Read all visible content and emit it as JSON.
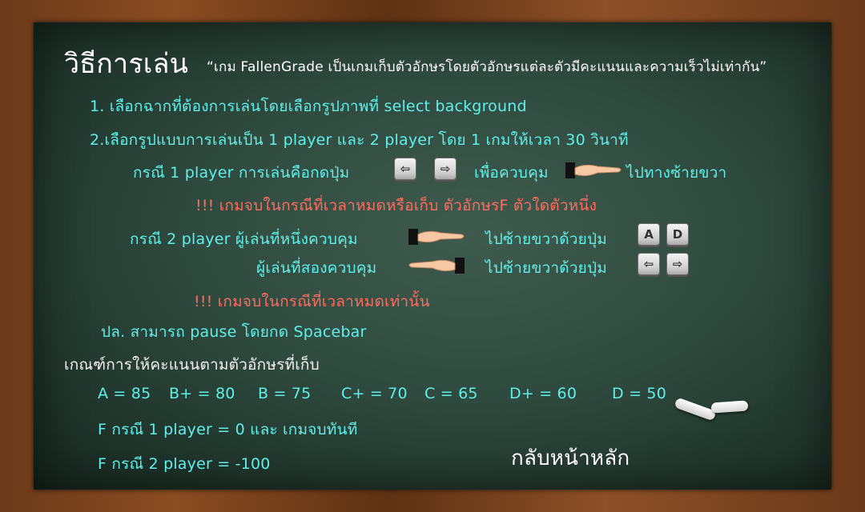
{
  "title": "วิธีการเล่น",
  "tagline": "“เกม FallenGrade เป็นเกมเก็บตัวอักษรโดยตัวอักษรแต่ละตัวมีคะแนนและความเร็วไม่เท่ากัน”",
  "steps": {
    "step1": "1. เลือกฉากที่ต้องการเล่นโดยเลือกรูปภาพที่ select background",
    "step2": "2.เลือกรูปแบบการเล่นเป็น 1 player และ 2 player โดย 1 เกมให้เวลา 30 วินาที"
  },
  "one_player": {
    "prefix": "กรณี 1 player การเล่นคือกดปุ่ม",
    "mid": "เพื่อควบคุม",
    "suffix": "ไปทางซ้ายขวา",
    "end_rule": "!!! เกมจบในกรณีที่เวลาหมดหรือเก็บ ตัวอักษรF ตัวใดตัวหนึ่ง"
  },
  "two_player": {
    "p1_prefix": "กรณี 2 player ผู้เล่นที่หนึ่งควบคุม",
    "p1_suffix": "ไปซ้ายขวาด้วยปุ่ม",
    "p2_prefix": "ผู้เล่นที่สองควบคุม",
    "p2_suffix": "ไปซ้ายขวาด้วยปุ่ม",
    "end_rule": "!!! เกมจบในกรณีที่เวลาหมดเท่านั้น"
  },
  "note": "ปล. สามารถ pause โดยกด Spacebar",
  "keys": {
    "a": "A",
    "d": "D",
    "left_arrow": "⇦",
    "right_arrow": "⇨"
  },
  "scoring": {
    "heading": "เกณฑ์การให้คะแนนตามตัวอักษรที่เก็บ",
    "grades": [
      "A = 85",
      "B+ = 80",
      "B = 75",
      "C+ = 70",
      "C = 65",
      "D+ = 60",
      "D = 50"
    ],
    "f_one": "F กรณี 1 player = 0 และ เกมจบทันที",
    "f_two": "F กรณี 2 player = -100"
  },
  "back_home": "กลับหน้าหลัก",
  "colors": {
    "instruction": "#5ff0ea",
    "warning": "#ff6b5e",
    "heading": "#ffffff",
    "board": "#2f4a3e",
    "frame": "#8a4c22"
  },
  "icons": [
    "left-arrow-key-icon",
    "right-arrow-key-icon",
    "a-key-icon",
    "d-key-icon",
    "hand-pointing-right-icon",
    "hand-pointing-left-icon",
    "chalk-icon"
  ]
}
